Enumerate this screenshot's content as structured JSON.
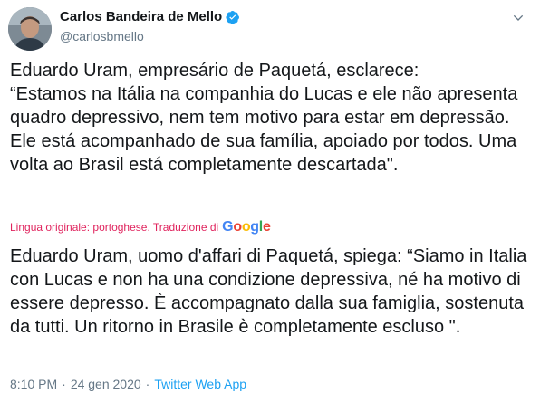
{
  "tweet": {
    "author_name": "Carlos Bandeira de Mello",
    "author_handle": "@carlosbmello_",
    "original_text": "Eduardo Uram, empresário de Paquetá, esclarece:\n“Estamos na Itália na companhia do Lucas e ele não apresenta quadro depressivo, nem tem motivo para estar em depressão. Ele está acompanhado de sua família, apoiado por todos. Uma volta ao Brasil está completamente descartada\".",
    "translation_label": "Lingua originale: portoghese. Traduzione di",
    "translation_provider": "Google",
    "translated_text": "Eduardo Uram, uomo d'affari di Paquetá, spiega: “Siamo in Italia con Lucas e non ha una condizione depressiva, né ha motivo di essere depresso. È accompagnato dalla sua famiglia, sostenuta da tutti. Un ritorno in Brasile è completamente escluso \".",
    "time": "8:10 PM",
    "separator": "·",
    "date": "24 gen 2020",
    "source_app": "Twitter Web App"
  },
  "colors": {
    "link": "#1da1f2",
    "translation_label": "#e0245e",
    "muted": "#657786",
    "text": "#14171a"
  },
  "icons": {
    "verified": "verified-badge-icon",
    "menu": "chevron-down-icon"
  }
}
